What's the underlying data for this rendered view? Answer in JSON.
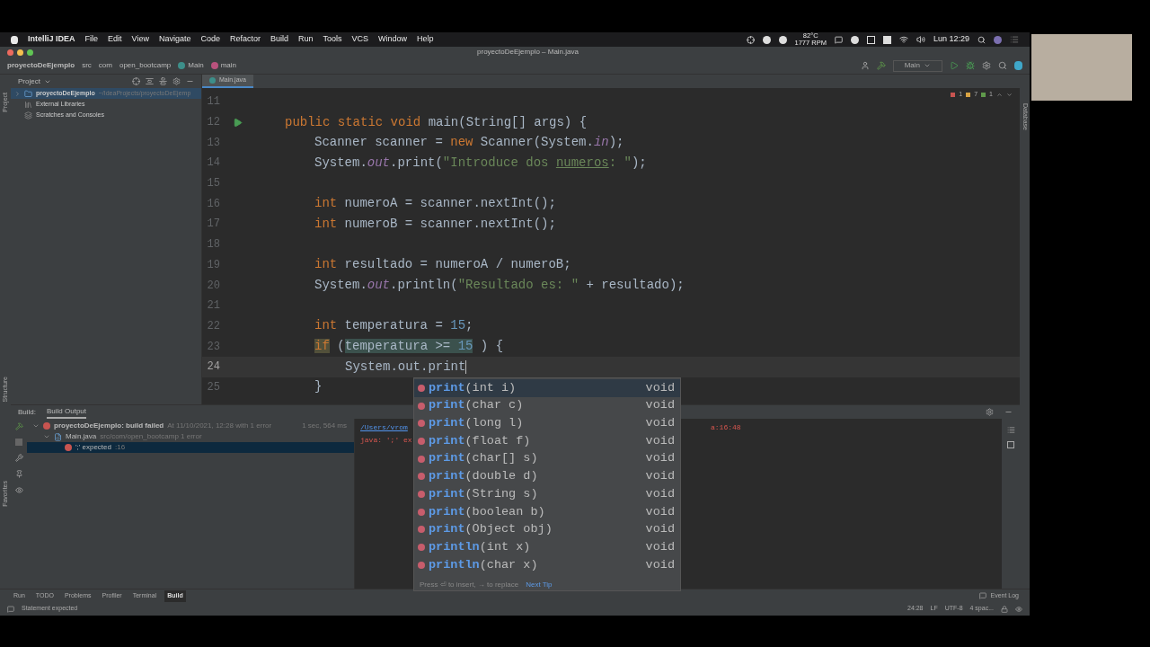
{
  "menu_bar": {
    "app": "IntelliJ IDEA",
    "items": [
      "File",
      "Edit",
      "View",
      "Navigate",
      "Code",
      "Refactor",
      "Build",
      "Run",
      "Tools",
      "VCS",
      "Window",
      "Help"
    ],
    "temperature": "82°C",
    "fan": "1777 RPM",
    "clock": "Lun 12:29"
  },
  "window": {
    "title": "proyectoDeEjemplo – Main.java"
  },
  "breadcrumbs": [
    {
      "label": "proyectoDeEjemplo",
      "kind": "project"
    },
    {
      "label": "src",
      "kind": "folder"
    },
    {
      "label": "com",
      "kind": "folder"
    },
    {
      "label": "open_bootcamp",
      "kind": "folder"
    },
    {
      "label": "Main",
      "kind": "class"
    },
    {
      "label": "main",
      "kind": "method"
    }
  ],
  "toolbar": {
    "run_config": "Main"
  },
  "side_tabs": {
    "left": [
      "Project",
      "Structure",
      "Favorites"
    ],
    "right": [
      "Database"
    ]
  },
  "project_panel": {
    "title": "Project",
    "tree": [
      {
        "label": "proyectoDeEjemplo",
        "path": "~/IdeaProjects/proyectoDeEjemp",
        "selected": true,
        "kind": "module"
      },
      {
        "label": "External Libraries",
        "selected": false,
        "kind": "library"
      },
      {
        "label": "Scratches and Consoles",
        "selected": false,
        "kind": "scratch"
      }
    ]
  },
  "editor": {
    "tabs": [
      {
        "label": "Main.java",
        "selected": true
      }
    ],
    "problems": {
      "errors": "1",
      "warnings": "7",
      "ok": "1"
    },
    "lines": [
      {
        "number": "11",
        "run": false,
        "current": false
      },
      {
        "number": "12",
        "run": true,
        "current": false,
        "kind": "member",
        "tokens": [
          {
            "t": "public static void ",
            "kind": "kw"
          },
          {
            "t": "main(String[] args) {",
            "kind": "plain"
          }
        ]
      },
      {
        "number": "13",
        "run": false,
        "current": false,
        "kind": "body",
        "tokens": [
          {
            "t": "Scanner scanner = ",
            "kind": "plain"
          },
          {
            "t": "new ",
            "kind": "kw"
          },
          {
            "t": "Scanner(System.",
            "kind": "plain"
          },
          {
            "t": "in",
            "kind": "field"
          },
          {
            "t": ");",
            "kind": "plain"
          }
        ]
      },
      {
        "number": "14",
        "run": false,
        "current": false,
        "kind": "body",
        "tokens": [
          {
            "t": "System.",
            "kind": "plain"
          },
          {
            "t": "out",
            "kind": "field"
          },
          {
            "t": ".print(",
            "kind": "plain"
          },
          {
            "t": "\"Introduce dos ",
            "kind": "str"
          },
          {
            "t": "numeros",
            "kind": "typo"
          },
          {
            "t": ": \"",
            "kind": "str"
          },
          {
            "t": ");",
            "kind": "plain"
          }
        ]
      },
      {
        "number": "15",
        "run": false,
        "current": false
      },
      {
        "number": "16",
        "run": false,
        "current": false,
        "kind": "body",
        "tokens": [
          {
            "t": "int ",
            "kind": "kw"
          },
          {
            "t": "numeroA = scanner.nextInt();",
            "kind": "plain"
          }
        ]
      },
      {
        "number": "17",
        "run": false,
        "current": false,
        "kind": "body",
        "tokens": [
          {
            "t": "int ",
            "kind": "kw"
          },
          {
            "t": "numeroB = scanner.nextInt();",
            "kind": "plain"
          }
        ]
      },
      {
        "number": "18",
        "run": false,
        "current": false
      },
      {
        "number": "19",
        "run": false,
        "current": false,
        "kind": "body",
        "tokens": [
          {
            "t": "int ",
            "kind": "kw"
          },
          {
            "t": "resultado = numeroA / numeroB;",
            "kind": "plain"
          }
        ]
      },
      {
        "number": "20",
        "run": false,
        "current": false,
        "kind": "body",
        "tokens": [
          {
            "t": "System.",
            "kind": "plain"
          },
          {
            "t": "out",
            "kind": "field"
          },
          {
            "t": ".println(",
            "kind": "plain"
          },
          {
            "t": "\"Resultado es: \"",
            "kind": "str"
          },
          {
            "t": " + resultado);",
            "kind": "plain"
          }
        ]
      },
      {
        "number": "21",
        "run": false,
        "current": false
      },
      {
        "number": "22",
        "run": false,
        "current": false,
        "kind": "body",
        "tokens": [
          {
            "t": "int ",
            "kind": "kw"
          },
          {
            "t": "temperatura = ",
            "kind": "plain"
          },
          {
            "t": "15",
            "kind": "num"
          },
          {
            "t": ";",
            "kind": "plain"
          }
        ]
      },
      {
        "number": "23",
        "run": false,
        "current": false,
        "kind": "body",
        "tokens": [
          {
            "t": "if",
            "kind": "hlkw"
          },
          {
            "t": " (",
            "kind": "plain"
          },
          {
            "t": "temperatura >= ",
            "kind": "hl"
          },
          {
            "t": "15",
            "kind": "hlnum"
          },
          {
            "t": " ) {",
            "kind": "plain"
          }
        ]
      },
      {
        "number": "24",
        "run": false,
        "current": true,
        "kind": "nested",
        "tokens": [
          {
            "t": "System.out.print",
            "kind": "plain"
          }
        ]
      },
      {
        "number": "25",
        "run": false,
        "current": false,
        "kind": "body",
        "tokens": [
          {
            "t": "}",
            "kind": "plain"
          }
        ]
      }
    ]
  },
  "completion": {
    "items": [
      {
        "name": "print",
        "params": "(int i)",
        "type": "void",
        "selected": true
      },
      {
        "name": "print",
        "params": "(char c)",
        "type": "void",
        "selected": false
      },
      {
        "name": "print",
        "params": "(long l)",
        "type": "void",
        "selected": false
      },
      {
        "name": "print",
        "params": "(float f)",
        "type": "void",
        "selected": false
      },
      {
        "name": "print",
        "params": "(char[] s)",
        "type": "void",
        "selected": false
      },
      {
        "name": "print",
        "params": "(double d)",
        "type": "void",
        "selected": false
      },
      {
        "name": "print",
        "params": "(String s)",
        "type": "void",
        "selected": false
      },
      {
        "name": "print",
        "params": "(boolean b)",
        "type": "void",
        "selected": false
      },
      {
        "name": "print",
        "params": "(Object obj)",
        "type": "void",
        "selected": false
      },
      {
        "name": "println",
        "params": "(int x)",
        "type": "void",
        "selected": false
      },
      {
        "name": "println",
        "params": "(char x)",
        "type": "void",
        "selected": false
      }
    ],
    "hint": "Press ⏎ to insert, → to replace",
    "tip": "Next Tip"
  },
  "build": {
    "label": "Build:",
    "tabs": [
      {
        "label": "Build Output",
        "selected": true
      }
    ],
    "tree": [
      {
        "label": "proyectoDeEjemplo: build failed",
        "detail": "At 11/10/2021, 12:28 with 1 error",
        "time": "1 sec, 564 ms",
        "selected": false,
        "kind": "root",
        "children": [
          {
            "label": "Main.java",
            "detail": "src/com/open_bootcamp 1 error",
            "selected": false,
            "kind": "file",
            "children": [
              {
                "label": "';' expected",
                "detail": ":16",
                "selected": true,
                "kind": "error"
              }
            ]
          }
        ]
      }
    ],
    "console": [
      {
        "text": "/Users/vrom",
        "suffix": "a:16:48",
        "kind": "link"
      },
      {
        "text": "java: ';' ex",
        "kind": "error"
      }
    ]
  },
  "tool_tabs": [
    {
      "label": "Run",
      "selected": false
    },
    {
      "label": "TODO",
      "selected": false
    },
    {
      "label": "Problems",
      "selected": false
    },
    {
      "label": "Profiler",
      "selected": false
    },
    {
      "label": "Terminal",
      "selected": false
    },
    {
      "label": "Build",
      "selected": true
    }
  ],
  "event_log": "Event Log",
  "status_bar": {
    "message": "Statement expected",
    "position": "24:28",
    "line_ending": "LF",
    "encoding": "UTF-8",
    "indent": "4 spac..."
  }
}
